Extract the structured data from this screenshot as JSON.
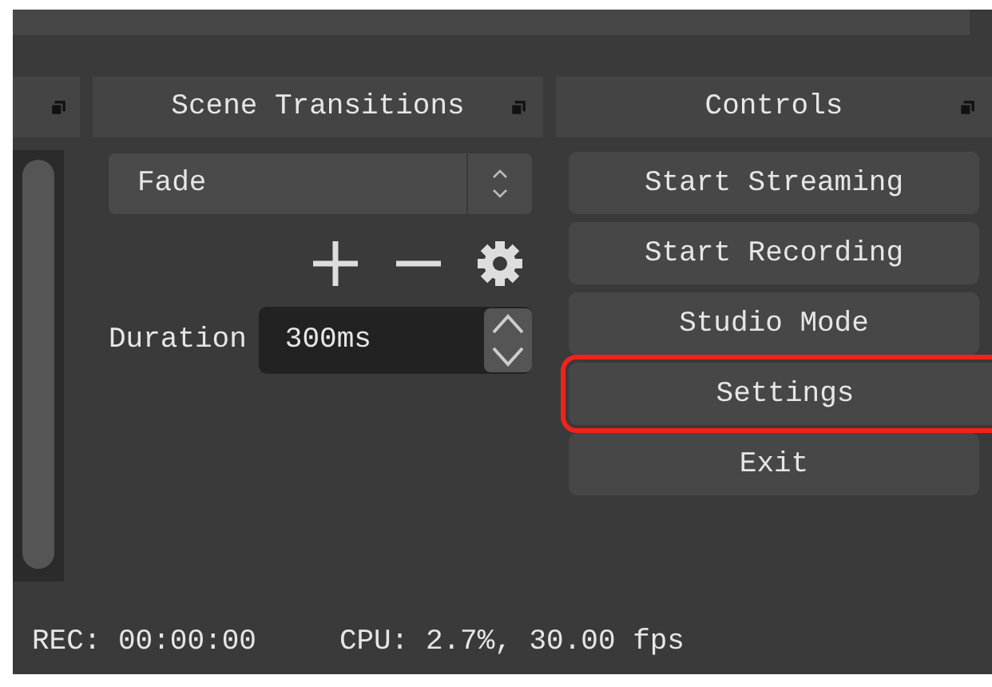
{
  "docks": [
    {
      "title": "Scene Transitions"
    },
    {
      "title": "Controls"
    }
  ],
  "transition": {
    "value": "Fade"
  },
  "duration": {
    "label": "Duration",
    "value": "300ms"
  },
  "controls": [
    {
      "label": "Start Streaming",
      "highlighted": false
    },
    {
      "label": "Start Recording",
      "highlighted": false
    },
    {
      "label": "Studio Mode",
      "highlighted": false
    },
    {
      "label": "Settings",
      "highlighted": true
    },
    {
      "label": "Exit",
      "highlighted": false
    }
  ],
  "status_bar": {
    "rec": "REC: 00:00:00",
    "cpu": "CPU: 2.7%, 30.00 fps"
  }
}
